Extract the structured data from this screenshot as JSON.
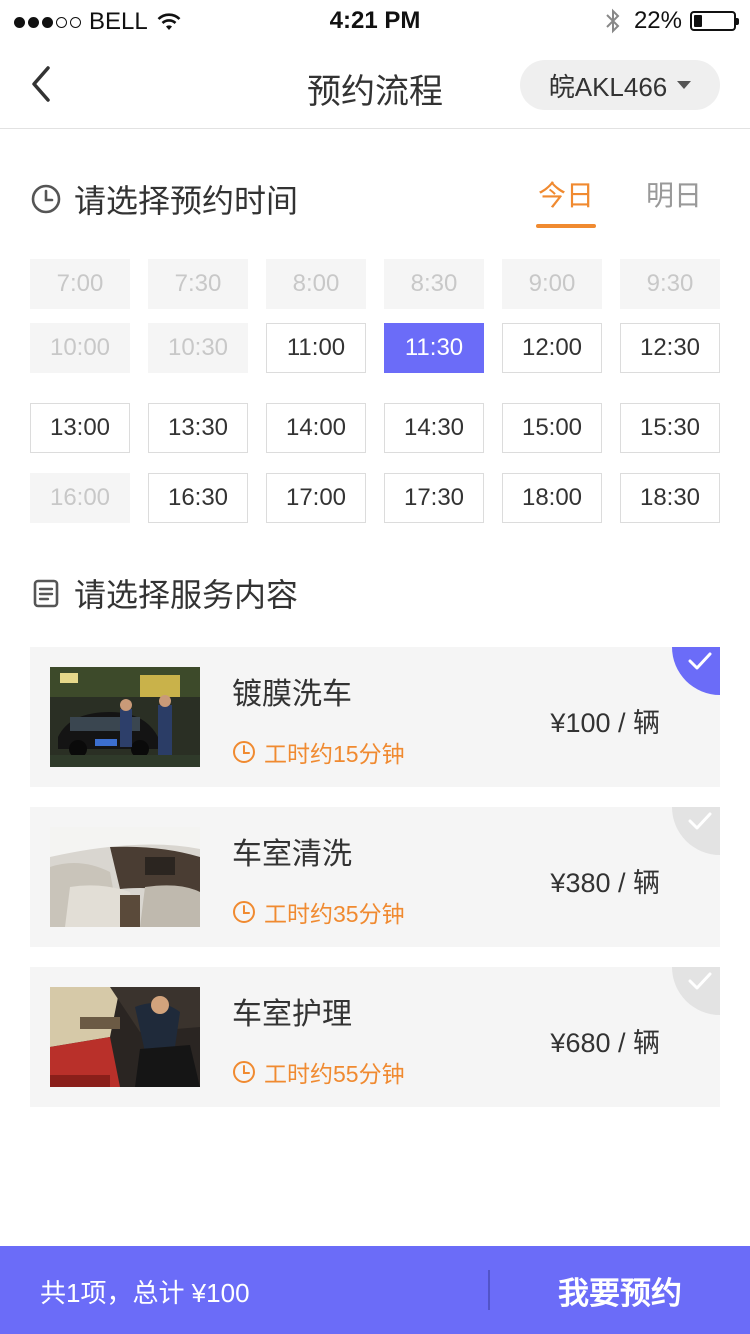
{
  "status_bar": {
    "carrier": "BELL",
    "signal_dots": [
      true,
      true,
      true,
      false,
      false
    ],
    "time": "4:21 PM",
    "battery": "22%",
    "battery_level": 0.22
  },
  "nav": {
    "title": "预约流程",
    "plate": "皖AKL466",
    "back_icon": "chevron-left-icon"
  },
  "time_section": {
    "title": "请选择预约时间",
    "icon": "clock-icon",
    "tabs": [
      {
        "label": "今日",
        "active": true
      },
      {
        "label": "明日",
        "active": false
      }
    ],
    "rows": [
      [
        {
          "label": "7:00",
          "state": "disabled"
        },
        {
          "label": "7:30",
          "state": "disabled"
        },
        {
          "label": "8:00",
          "state": "disabled"
        },
        {
          "label": "8:30",
          "state": "disabled"
        },
        {
          "label": "9:00",
          "state": "disabled"
        },
        {
          "label": "9:30",
          "state": "disabled"
        }
      ],
      [
        {
          "label": "10:00",
          "state": "disabled"
        },
        {
          "label": "10:30",
          "state": "disabled"
        },
        {
          "label": "11:00",
          "state": "available"
        },
        {
          "label": "11:30",
          "state": "selected"
        },
        {
          "label": "12:00",
          "state": "available"
        },
        {
          "label": "12:30",
          "state": "available"
        }
      ],
      [
        {
          "label": "13:00",
          "state": "available"
        },
        {
          "label": "13:30",
          "state": "available"
        },
        {
          "label": "14:00",
          "state": "available"
        },
        {
          "label": "14:30",
          "state": "available"
        },
        {
          "label": "15:00",
          "state": "available"
        },
        {
          "label": "15:30",
          "state": "available"
        }
      ],
      [
        {
          "label": "16:00",
          "state": "disabled"
        },
        {
          "label": "16:30",
          "state": "available"
        },
        {
          "label": "17:00",
          "state": "available"
        },
        {
          "label": "17:30",
          "state": "available"
        },
        {
          "label": "18:00",
          "state": "available"
        },
        {
          "label": "18:30",
          "state": "available"
        }
      ]
    ]
  },
  "service_section": {
    "title": "请选择服务内容",
    "icon": "document-list-icon",
    "services": [
      {
        "name": "镀膜洗车",
        "duration": "工时约15分钟",
        "price": "¥100 / 辆",
        "selected": true,
        "photo": "car-coating-wash-photo"
      },
      {
        "name": "车室清洗",
        "duration": "工时约35分钟",
        "price": "¥380 / 辆",
        "selected": false,
        "photo": "car-interior-clean-photo"
      },
      {
        "name": "车室护理",
        "duration": "工时约55分钟",
        "price": "¥680 / 辆",
        "selected": false,
        "photo": "car-interior-care-photo"
      }
    ]
  },
  "footer": {
    "summary": "共1项，总计 ¥100",
    "reserve_label": "我要预约"
  },
  "colors": {
    "accent": "#6b6cf8",
    "orange": "#f08a30",
    "disabled_bg": "#f5f5f5",
    "card_bg": "#f5f5f5"
  }
}
